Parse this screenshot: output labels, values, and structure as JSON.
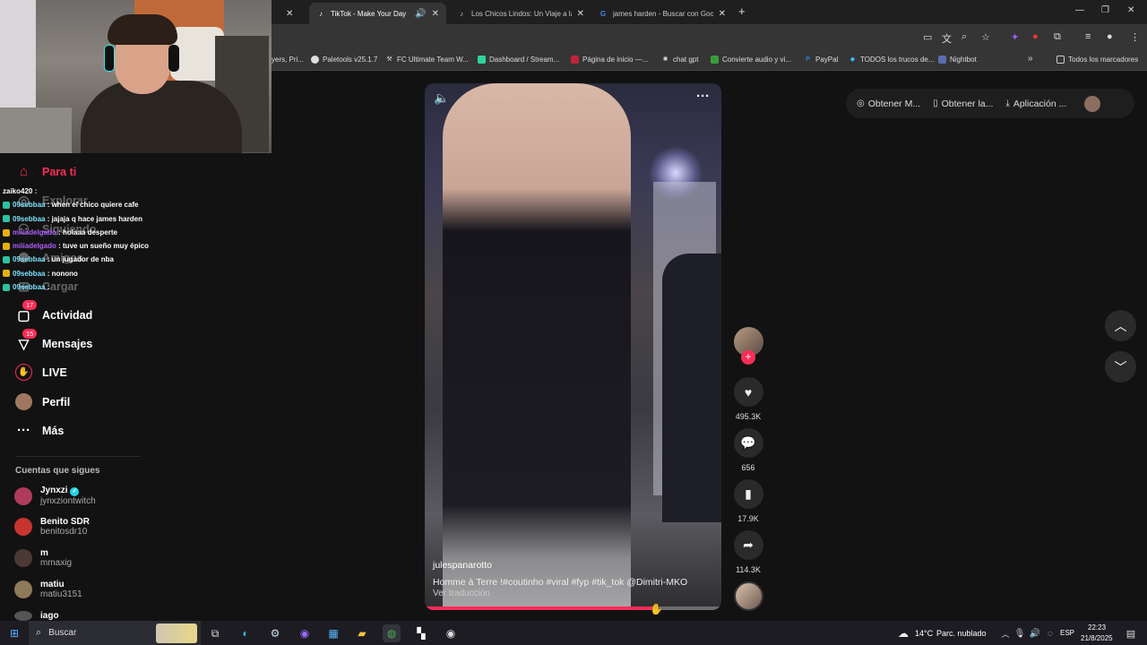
{
  "browser": {
    "tabs": [
      {
        "title": "TikTok - Make Your Day",
        "active": true
      },
      {
        "title": "Los Chicos Lindos: Un Viaje a la",
        "active": false
      },
      {
        "title": "james harden - Buscar con Goo",
        "active": false
      }
    ],
    "bookmarks": [
      "yers, Pri...",
      "Paletools v25.1.7",
      "FC Ultimate Team W...",
      "Dashboard / Stream...",
      "Página de inicio —...",
      "chat gpt",
      "Convierte audio y vi...",
      "PayPal",
      "TODOS los trucos de...",
      "Nightbot",
      "Todos los marcadores"
    ]
  },
  "sidebar": {
    "nav": [
      {
        "label": "Para ti",
        "icon": "home-icon"
      },
      {
        "label": "Explorar",
        "icon": "compass-icon"
      },
      {
        "label": "Siguiendo",
        "icon": "following-icon"
      },
      {
        "label": "Amigos",
        "icon": "friends-icon"
      },
      {
        "label": "Cargar",
        "icon": "upload-icon"
      },
      {
        "label": "Actividad",
        "icon": "activity-icon",
        "badge": "17"
      },
      {
        "label": "Mensajes",
        "icon": "messages-icon",
        "badge": "15"
      },
      {
        "label": "LIVE",
        "icon": "live-icon"
      },
      {
        "label": "Perfil",
        "icon": "profile-icon"
      },
      {
        "label": "Más",
        "icon": "more-icon"
      }
    ],
    "following_title": "Cuentas que sigues",
    "following": [
      {
        "name": "Jynxzi",
        "username": "jynxziontwitch",
        "verified": true
      },
      {
        "name": "Benito SDR",
        "username": "benitosdr10"
      },
      {
        "name": "m",
        "username": "mmaxig"
      },
      {
        "name": "matiu",
        "username": "matiu3151"
      },
      {
        "name": "iago",
        "username": ""
      }
    ]
  },
  "chat": [
    {
      "user": "zaiko420",
      "msg": "",
      "color": "#ffffff",
      "badge": ""
    },
    {
      "user": "09sebbaa",
      "msg": "when el chico quiere cafe",
      "color": "#7be3ff",
      "badge": "#2bc3a0"
    },
    {
      "user": "09sebbaa",
      "msg": "jajaja q hace james harden",
      "color": "#7be3ff",
      "badge": "#2bc3a0"
    },
    {
      "user": "miiiadelgado",
      "msg": "holaaa desperte",
      "color": "#b05cff",
      "badge": "#e5b00a"
    },
    {
      "user": "miiiadelgado",
      "msg": "tuve un sueño muy épico",
      "color": "#b05cff",
      "badge": "#e5b00a"
    },
    {
      "user": "09sebbaa",
      "msg": "un jugador de nba",
      "color": "#7be3ff",
      "badge": "#2bc3a0"
    },
    {
      "user": "09sebbaa",
      "msg": "nonono",
      "color": "#7be3ff",
      "badge": "#e5b00a"
    },
    {
      "user": "09sebbaa",
      "msg": "",
      "color": "#7be3ff",
      "badge": "#2bc3a0"
    }
  ],
  "video": {
    "author": "julespanarotto",
    "caption": "Homme à Terre !#coutinho #viral #fyp #tik_tok @Dimitri-MKO",
    "translate": "Ver traducción",
    "progress": 0.77,
    "likes": "495.3K",
    "comments": "656",
    "saves": "17.9K",
    "shares": "114.3K"
  },
  "topbar": {
    "items": [
      "Obtener M...",
      "Obtener la...",
      "Aplicación ..."
    ]
  },
  "taskbar": {
    "search_placeholder": "Buscar",
    "weather": "14°C",
    "weather_desc": "Parc. nublado",
    "lang": "ESP",
    "time": "22:23",
    "date": "21/8/2025"
  },
  "colors": {
    "accent": "#fe2c55"
  }
}
